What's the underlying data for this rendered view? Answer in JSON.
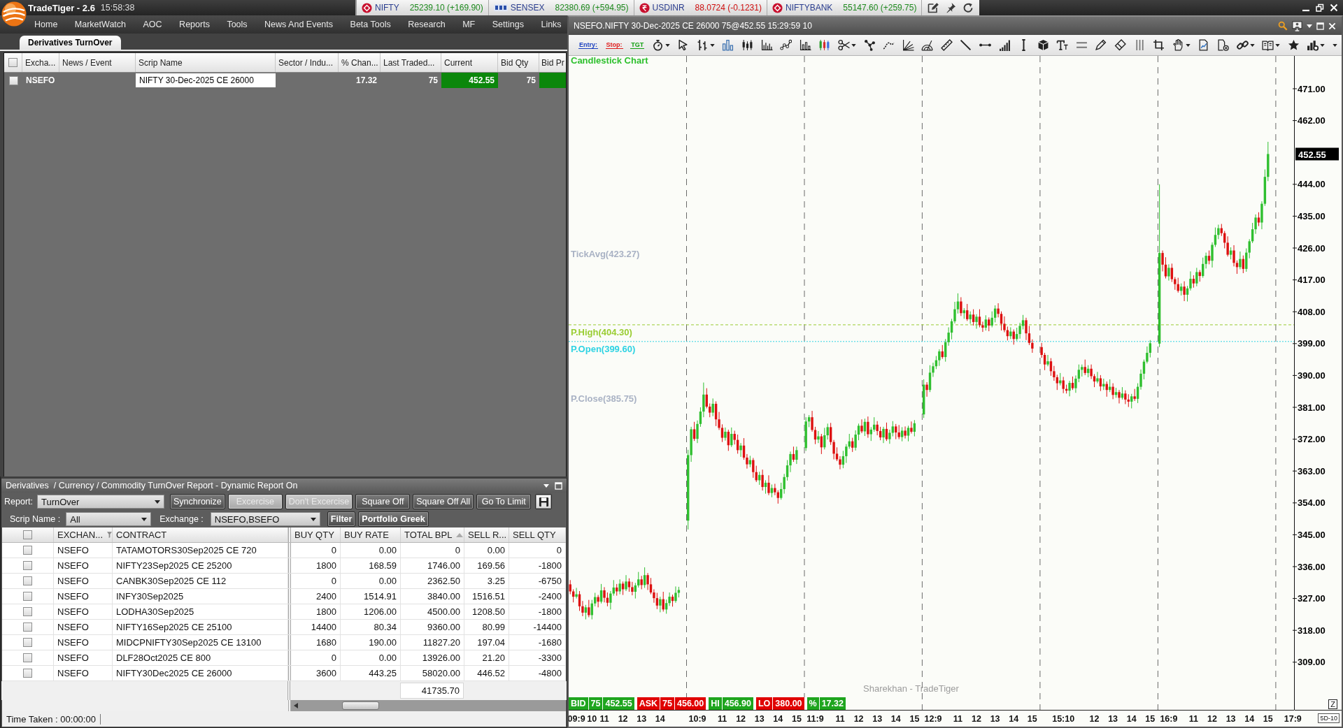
{
  "app": {
    "title": "TradeTiger - 2.6",
    "clock": "15:58:38"
  },
  "tickers": [
    {
      "name": "NIFTY",
      "value": "25239.10 (+169.90)",
      "rising": true,
      "kind": "nse"
    },
    {
      "name": "SENSEX",
      "value": "82380.69 (+594.95)",
      "rising": true,
      "kind": "bse"
    },
    {
      "name": "USDINR",
      "value": "88.0724 (-0.1231)",
      "rising": false,
      "kind": "rupee"
    },
    {
      "name": "NIFTYBANK",
      "value": "55147.60 (+259.75)",
      "rising": true,
      "kind": "nse"
    }
  ],
  "menu": [
    "Home",
    "MarketWatch",
    "AOC",
    "Reports",
    "Tools",
    "News And Events",
    "Beta Tools",
    "Research",
    "MF",
    "Settings",
    "Links"
  ],
  "watchlist": {
    "tabs": [
      {
        "label": "Derivatives TurnOver",
        "selected": true
      }
    ],
    "header_checked": false,
    "columns": [
      "Excha...",
      "News / Event",
      "Scrip Name",
      "Sector / Indu...",
      "% Chan...",
      "Last Traded...",
      "Current",
      "Bid Qty",
      "Bid Pr"
    ],
    "rows": [
      {
        "checked": false,
        "exchange": "NSEFO",
        "scrip_name": "NIFTY 30-Dec-2025 CE 26000",
        "change_pct": "17.32",
        "last_traded": "75",
        "current": "452.55",
        "bid_qty": "75",
        "rising": true
      }
    ]
  },
  "report": {
    "title": "Derivatives  / Currency / Commodity TurnOver Report - Dynamic Report On",
    "report_label": "Report:",
    "report_type": "TurnOver",
    "buttons": [
      {
        "label": "Synchronize",
        "disabled": false
      },
      {
        "label": "Excercise",
        "disabled": true
      },
      {
        "label": "Don't Excercise",
        "disabled": true
      },
      {
        "label": "Square Off",
        "disabled": false
      },
      {
        "label": "Square Off All",
        "disabled": false
      },
      {
        "label": "Go To Limit",
        "disabled": false
      }
    ],
    "scrip_label": "Scrip Name :",
    "scrip_name": "All",
    "exchange_label": "Exchange :",
    "exchange": "NSEFO,BSEFO",
    "filter_buttons": [
      "Filter",
      "Portfolio Greek"
    ],
    "header_checked": false,
    "columns": [
      {
        "label": "EXCHAN...",
        "filter": true,
        "sorted": false
      },
      {
        "label": "CONTRACT",
        "filter": false,
        "sorted": false
      },
      {
        "label": "BUY QTY",
        "filter": false,
        "sorted": false
      },
      {
        "label": "BUY RATE",
        "filter": false,
        "sorted": false
      },
      {
        "label": "TOTAL BPL",
        "filter": false,
        "sorted": true
      },
      {
        "label": "SELL R...",
        "filter": false,
        "sorted": false
      },
      {
        "label": "SELL QTY",
        "filter": false,
        "sorted": false
      }
    ],
    "rows": [
      {
        "checked": false,
        "exchange": "NSEFO",
        "contract": "TATAMOTORS30Sep2025 CE 720",
        "buy_qty": "0",
        "buy_rate": "0.00",
        "total_bpl": "0",
        "sell_rate": "0.00",
        "sell_qty": "0"
      },
      {
        "checked": false,
        "exchange": "NSEFO",
        "contract": "NIFTY23Sep2025 CE 25200",
        "buy_qty": "1800",
        "buy_rate": "168.59",
        "total_bpl": "1746.00",
        "sell_rate": "169.56",
        "sell_qty": "-1800"
      },
      {
        "checked": false,
        "exchange": "NSEFO",
        "contract": "CANBK30Sep2025 CE 112",
        "buy_qty": "0",
        "buy_rate": "0.00",
        "total_bpl": "2362.50",
        "sell_rate": "3.25",
        "sell_qty": "-6750"
      },
      {
        "checked": false,
        "exchange": "NSEFO",
        "contract": "INFY30Sep2025",
        "buy_qty": "2400",
        "buy_rate": "1514.91",
        "total_bpl": "3840.00",
        "sell_rate": "1516.51",
        "sell_qty": "-2400"
      },
      {
        "checked": false,
        "exchange": "NSEFO",
        "contract": "LODHA30Sep2025",
        "buy_qty": "1800",
        "buy_rate": "1206.00",
        "total_bpl": "4500.00",
        "sell_rate": "1208.50",
        "sell_qty": "-1800"
      },
      {
        "checked": false,
        "exchange": "NSEFO",
        "contract": "NIFTY16Sep2025 CE 25100",
        "buy_qty": "14400",
        "buy_rate": "80.34",
        "total_bpl": "9360.00",
        "sell_rate": "80.99",
        "sell_qty": "-14400"
      },
      {
        "checked": false,
        "exchange": "NSEFO",
        "contract": "MIDCPNIFTY30Sep2025 CE 13100",
        "buy_qty": "1680",
        "buy_rate": "190.00",
        "total_bpl": "11827.20",
        "sell_rate": "197.04",
        "sell_qty": "-1680"
      },
      {
        "checked": false,
        "exchange": "NSEFO",
        "contract": "DLF28Oct2025 CE 800",
        "buy_qty": "0",
        "buy_rate": "0.00",
        "total_bpl": "13926.00",
        "sell_rate": "21.20",
        "sell_qty": "-3300"
      },
      {
        "checked": false,
        "exchange": "NSEFO",
        "contract": "NIFTY30Dec2025 CE 26000",
        "buy_qty": "3600",
        "buy_rate": "443.25",
        "total_bpl": "58020.00",
        "sell_rate": "446.52",
        "sell_qty": "-4800"
      }
    ],
    "total_bpl": "41735.70",
    "status": "Time Taken : 00:00:00"
  },
  "chart": {
    "title": "NSEFO.NIFTY 30-Dec-2025 CE 26000 75@452.55 15:29:59 10",
    "order_tags": [
      {
        "label": "Entry:",
        "color": "#1a3fc0"
      },
      {
        "label": "Stop:",
        "color": "#e01b1b"
      },
      {
        "label": "TGT",
        "color": "#12a012"
      }
    ],
    "chart_data": {
      "type": "candlestick",
      "title": "Candlestick Chart",
      "categories": [
        null,
        null,
        "09:9",
        null,
        null,
        null,
        null,
        "10",
        null,
        null,
        null,
        "11",
        null,
        null,
        null,
        null,
        null,
        "12",
        null,
        null,
        null,
        null,
        null,
        "13",
        null,
        null,
        null,
        null,
        null,
        "14",
        null,
        null,
        null,
        null,
        null,
        null,
        null,
        null,
        null,
        null,
        null,
        "10:9",
        null,
        null,
        null,
        null,
        null,
        null,
        null,
        "11",
        null,
        null,
        null,
        null,
        null,
        "12",
        null,
        null,
        null,
        null,
        null,
        "13",
        null,
        null,
        null,
        null,
        null,
        "14",
        null,
        null,
        null,
        null,
        null,
        "15",
        null,
        null,
        null,
        null,
        null,
        "11:9",
        null,
        null,
        null,
        null,
        null,
        null,
        null,
        "11",
        null,
        null,
        null,
        null,
        null,
        "12",
        null,
        null,
        null,
        null,
        null,
        "13",
        null,
        null,
        null,
        null,
        null,
        "14",
        null,
        null,
        null,
        null,
        null,
        "15",
        null,
        null,
        null,
        null,
        null,
        "12:9",
        null,
        null,
        null,
        null,
        null,
        null,
        null,
        "11",
        null,
        null,
        null,
        null,
        null,
        "12",
        null,
        null,
        null,
        null,
        null,
        "13",
        null,
        null,
        null,
        null,
        null,
        "14",
        null,
        null,
        null,
        null,
        null,
        "15",
        null,
        null,
        null,
        null,
        null,
        null,
        null,
        null,
        null,
        "15:10",
        null,
        null,
        null,
        null,
        null,
        null,
        null,
        null,
        null,
        "12",
        null,
        null,
        null,
        null,
        null,
        "13",
        null,
        null,
        null,
        null,
        null,
        "14",
        null,
        null,
        null,
        null,
        null,
        "15",
        null,
        null,
        null,
        null,
        null,
        "16:9",
        null,
        null,
        null,
        null,
        null,
        null,
        null,
        "11",
        null,
        null,
        null,
        null,
        null,
        "12",
        null,
        null,
        null,
        null,
        null,
        "13",
        null,
        null,
        null,
        null,
        null,
        "14",
        null,
        null,
        null,
        null,
        null,
        "15",
        null,
        null,
        null,
        null,
        null,
        null,
        null,
        "17:9"
      ],
      "ohlc": [
        [
          331.0,
          332.2,
          328.2,
          329.0
        ],
        [
          329.0,
          329.6,
          325.9,
          327.5
        ],
        [
          327.5,
          330.0,
          327.0,
          328.2
        ],
        [
          328.2,
          329.1,
          323.5,
          324.8
        ],
        [
          324.8,
          326.3,
          322.0,
          323.0
        ],
        [
          323.0,
          325.2,
          321.1,
          324.5
        ],
        [
          324.5,
          326.6,
          321.7,
          322.3
        ],
        [
          322.3,
          326.6,
          321.1,
          325.6
        ],
        [
          325.6,
          328.6,
          324.8,
          327.4
        ],
        [
          327.4,
          328.0,
          324.5,
          326.1
        ],
        [
          326.1,
          331.1,
          325.6,
          329.3
        ],
        [
          329.3,
          330.2,
          325.9,
          327.2
        ],
        [
          327.2,
          328.7,
          324.8,
          325.8
        ],
        [
          325.8,
          329.1,
          323.9,
          328.4
        ],
        [
          328.4,
          332.2,
          327.8,
          330.1
        ],
        [
          330.1,
          331.1,
          327.8,
          329.0
        ],
        [
          329.0,
          332.4,
          328.2,
          331.2
        ],
        [
          331.2,
          331.8,
          328.0,
          329.6
        ],
        [
          329.6,
          333.6,
          329.1,
          331.8
        ],
        [
          331.8,
          332.7,
          328.9,
          330.2
        ],
        [
          330.2,
          331.7,
          327.9,
          328.9
        ],
        [
          328.9,
          331.4,
          327.0,
          330.7
        ],
        [
          330.7,
          334.5,
          330.1,
          332.4
        ],
        [
          332.4,
          333.4,
          329.6,
          330.8
        ],
        [
          330.8,
          335.8,
          330.0,
          333.6
        ],
        [
          333.6,
          334.2,
          329.4,
          331.0
        ],
        [
          331.0,
          332.8,
          328.2,
          328.7
        ],
        [
          328.7,
          329.6,
          325.8,
          327.1
        ],
        [
          327.1,
          328.6,
          324.0,
          325.0
        ],
        [
          325.0,
          327.5,
          323.1,
          326.8
        ],
        [
          326.8,
          328.9,
          323.3,
          323.9
        ],
        [
          323.9,
          326.7,
          322.7,
          325.7
        ],
        [
          325.7,
          328.7,
          324.9,
          327.5
        ],
        [
          327.5,
          328.1,
          324.7,
          326.3
        ],
        [
          326.3,
          330.4,
          325.8,
          328.6
        ],
        [
          328.6,
          330.3,
          327.3,
          329.4
        ],
        null,
        null,
        [
          349.0,
          369.0,
          346.5,
          367.5
        ],
        [
          367.5,
          375.5,
          365.6,
          374.8
        ],
        [
          374.8,
          376.9,
          371.5,
          372.1
        ],
        [
          372.1,
          377.3,
          370.9,
          376.3
        ],
        [
          376.3,
          381.0,
          375.5,
          379.8
        ],
        [
          379.8,
          388.0,
          378.2,
          384.6
        ],
        [
          384.6,
          386.4,
          380.7,
          381.2
        ],
        [
          381.2,
          382.1,
          378.2,
          379.5
        ],
        [
          379.5,
          383.5,
          378.5,
          382.0
        ],
        [
          382.0,
          382.7,
          375.7,
          377.6
        ],
        [
          377.6,
          379.7,
          374.6,
          375.2
        ],
        [
          375.2,
          376.2,
          371.2,
          372.4
        ],
        [
          372.4,
          375.3,
          371.6,
          374.1
        ],
        [
          374.1,
          374.7,
          368.7,
          370.3
        ],
        [
          370.3,
          375.3,
          369.8,
          373.5
        ],
        [
          373.5,
          374.4,
          370.5,
          371.8
        ],
        [
          371.8,
          373.3,
          367.9,
          368.9
        ],
        [
          368.9,
          370.9,
          367.0,
          370.2
        ],
        [
          370.2,
          372.3,
          366.2,
          366.8
        ],
        [
          366.8,
          367.8,
          363.7,
          364.9
        ],
        [
          364.9,
          367.3,
          364.1,
          366.1
        ],
        [
          366.1,
          366.7,
          361.1,
          362.7
        ],
        [
          362.7,
          364.5,
          359.9,
          360.4
        ],
        [
          360.4,
          362.8,
          359.1,
          361.9
        ],
        [
          361.9,
          363.4,
          357.5,
          358.5
        ],
        [
          358.5,
          360.4,
          356.6,
          359.7
        ],
        [
          359.7,
          361.8,
          356.2,
          356.8
        ],
        [
          356.8,
          359.2,
          355.6,
          358.2
        ],
        [
          358.2,
          359.4,
          356.2,
          357.0
        ],
        [
          357.0,
          357.6,
          353.8,
          355.4
        ],
        [
          355.4,
          359.7,
          354.9,
          357.9
        ],
        [
          357.9,
          362.2,
          356.6,
          361.3
        ],
        [
          361.3,
          366.1,
          360.3,
          364.6
        ],
        [
          364.6,
          368.5,
          362.7,
          367.8
        ],
        [
          367.8,
          369.9,
          365.6,
          366.2
        ],
        [
          366.2,
          369.9,
          365.0,
          368.9
        ],
        null,
        null,
        [
          369.5,
          378.2,
          368.7,
          377.0
        ],
        [
          377.0,
          378.8,
          375.4,
          378.2
        ],
        [
          378.2,
          380.0,
          374.1,
          374.6
        ],
        [
          374.6,
          375.5,
          370.6,
          371.9
        ],
        [
          371.9,
          374.3,
          370.9,
          372.8
        ],
        [
          372.8,
          373.5,
          367.8,
          369.7
        ],
        [
          369.7,
          375.2,
          369.1,
          373.1
        ],
        [
          373.1,
          376.4,
          371.9,
          375.4
        ],
        [
          375.4,
          376.6,
          370.4,
          371.2
        ],
        [
          371.2,
          371.8,
          366.3,
          367.9
        ],
        [
          367.9,
          369.7,
          365.8,
          366.3
        ],
        [
          366.3,
          367.2,
          363.5,
          364.8
        ],
        [
          364.8,
          368.7,
          363.8,
          367.2
        ],
        [
          367.2,
          370.6,
          365.3,
          369.9
        ],
        [
          369.9,
          373.5,
          369.3,
          371.4
        ],
        [
          371.4,
          372.4,
          368.4,
          369.6
        ],
        [
          369.6,
          374.5,
          368.8,
          373.3
        ],
        [
          373.3,
          376.4,
          371.7,
          375.8
        ],
        [
          375.8,
          377.6,
          373.7,
          374.2
        ],
        [
          374.2,
          377.8,
          372.9,
          376.9
        ],
        [
          376.9,
          378.4,
          372.4,
          373.4
        ],
        [
          373.4,
          375.4,
          371.5,
          374.7
        ],
        [
          374.7,
          378.2,
          374.1,
          376.1
        ],
        [
          376.1,
          377.1,
          373.1,
          374.3
        ],
        [
          374.3,
          375.5,
          371.7,
          372.5
        ],
        [
          372.5,
          375.5,
          370.9,
          374.9
        ],
        [
          374.9,
          376.7,
          371.5,
          372.0
        ],
        [
          372.0,
          374.7,
          370.7,
          373.8
        ],
        [
          373.8,
          377.1,
          372.8,
          375.6
        ],
        [
          375.6,
          376.3,
          372.0,
          373.9
        ],
        [
          373.9,
          376.0,
          372.0,
          372.6
        ],
        [
          372.6,
          375.4,
          371.4,
          374.4
        ],
        [
          374.4,
          375.6,
          372.2,
          373.0
        ],
        [
          373.0,
          375.8,
          371.4,
          375.2
        ],
        [
          375.2,
          377.0,
          373.6,
          374.1
        ],
        [
          374.1,
          377.4,
          372.8,
          376.5
        ],
        null,
        null,
        [
          379.0,
          388.9,
          378.0,
          387.4
        ],
        [
          387.4,
          388.1,
          384.0,
          385.9
        ],
        [
          385.9,
          392.9,
          385.3,
          390.8
        ],
        [
          390.8,
          393.6,
          389.6,
          392.6
        ],
        [
          392.6,
          395.5,
          391.8,
          394.3
        ],
        [
          394.3,
          397.4,
          392.7,
          396.8
        ],
        [
          396.8,
          398.6,
          394.7,
          395.2
        ],
        [
          395.2,
          400.3,
          393.9,
          399.4
        ],
        [
          399.4,
          403.6,
          398.4,
          402.1
        ],
        [
          402.1,
          406.0,
          400.2,
          405.3
        ],
        [
          405.3,
          410.8,
          404.7,
          408.7
        ],
        [
          408.7,
          413.2,
          407.5,
          410.9
        ],
        [
          410.9,
          412.1,
          406.8,
          407.6
        ],
        [
          407.6,
          409.0,
          406.0,
          408.4
        ],
        [
          408.4,
          410.2,
          405.4,
          405.9
        ],
        [
          405.9,
          408.1,
          404.6,
          407.2
        ],
        [
          407.2,
          408.7,
          404.1,
          405.1
        ],
        [
          405.1,
          407.3,
          403.2,
          406.6
        ],
        [
          406.6,
          408.7,
          403.6,
          404.2
        ],
        [
          404.2,
          405.2,
          402.3,
          403.5
        ],
        [
          403.5,
          407.0,
          402.7,
          405.8
        ],
        [
          405.8,
          406.4,
          402.5,
          404.1
        ],
        [
          404.1,
          408.1,
          403.6,
          406.3
        ],
        [
          406.3,
          409.8,
          405.0,
          408.9
        ],
        [
          408.9,
          410.4,
          406.4,
          407.4
        ],
        [
          407.4,
          408.1,
          402.7,
          404.6
        ],
        [
          404.6,
          406.7,
          402.2,
          402.8
        ],
        [
          402.8,
          403.8,
          399.9,
          401.1
        ],
        [
          401.1,
          403.6,
          400.3,
          402.4
        ],
        [
          402.4,
          403.0,
          398.7,
          400.3
        ],
        [
          400.3,
          403.5,
          399.8,
          401.7
        ],
        [
          401.7,
          404.9,
          400.4,
          404.0
        ],
        [
          404.0,
          407.1,
          403.0,
          405.6
        ],
        [
          405.6,
          406.3,
          400.0,
          401.9
        ],
        [
          401.9,
          404.0,
          398.6,
          399.2
        ],
        [
          399.2,
          400.2,
          396.4,
          397.6
        ],
        null,
        null,
        [
          398.0,
          399.2,
          395.0,
          395.8
        ],
        [
          395.8,
          396.4,
          391.5,
          393.1
        ],
        [
          393.1,
          395.8,
          392.6,
          394.0
        ],
        [
          394.0,
          394.9,
          389.9,
          391.2
        ],
        [
          391.2,
          392.7,
          388.5,
          389.5
        ],
        [
          389.5,
          390.2,
          385.9,
          387.8
        ],
        [
          387.8,
          390.7,
          387.2,
          388.6
        ],
        [
          388.6,
          389.6,
          385.0,
          386.2
        ],
        [
          386.2,
          387.4,
          384.9,
          385.7
        ],
        [
          385.7,
          388.5,
          384.1,
          387.9
        ],
        [
          387.9,
          389.7,
          385.9,
          386.4
        ],
        [
          386.4,
          390.0,
          385.1,
          389.1
        ],
        [
          389.1,
          393.1,
          388.1,
          391.6
        ],
        [
          391.6,
          393.1,
          389.7,
          392.4
        ],
        [
          392.4,
          394.5,
          390.1,
          390.7
        ],
        [
          390.7,
          392.9,
          389.5,
          391.9
        ],
        [
          391.9,
          393.1,
          389.0,
          389.8
        ],
        [
          389.8,
          390.4,
          386.7,
          388.3
        ],
        [
          388.3,
          391.0,
          387.8,
          389.2
        ],
        [
          389.2,
          390.1,
          385.6,
          386.9
        ],
        [
          386.9,
          389.1,
          385.9,
          387.6
        ],
        [
          387.6,
          388.3,
          384.0,
          385.9
        ],
        [
          385.9,
          388.9,
          385.3,
          386.8
        ],
        [
          386.8,
          387.8,
          383.3,
          384.5
        ],
        [
          384.5,
          386.5,
          383.7,
          385.3
        ],
        [
          385.3,
          385.9,
          382.1,
          383.7
        ],
        [
          383.7,
          386.7,
          383.2,
          384.9
        ],
        [
          384.9,
          385.8,
          381.9,
          383.2
        ],
        [
          383.2,
          384.7,
          381.1,
          382.6
        ],
        [
          382.6,
          384.8,
          380.7,
          384.1
        ],
        [
          384.1,
          386.2,
          382.8,
          383.4
        ],
        [
          383.4,
          387.8,
          382.2,
          386.8
        ],
        [
          386.8,
          391.7,
          386.0,
          390.5
        ],
        [
          390.5,
          394.5,
          388.9,
          393.9
        ],
        [
          393.9,
          398.2,
          393.4,
          396.4
        ],
        [
          396.4,
          400.0,
          395.1,
          399.1
        ],
        null,
        null,
        [
          399.0,
          444.0,
          398.0,
          424.6
        ],
        [
          424.6,
          425.3,
          419.4,
          421.3
        ],
        [
          421.3,
          423.4,
          417.4,
          418.0
        ],
        [
          418.0,
          421.4,
          416.8,
          420.4
        ],
        [
          420.4,
          421.6,
          416.4,
          417.2
        ],
        [
          417.2,
          417.8,
          414.2,
          415.8
        ],
        [
          415.8,
          417.6,
          413.4,
          413.9
        ],
        [
          413.9,
          416.0,
          412.6,
          415.1
        ],
        [
          415.1,
          416.6,
          411.0,
          412.8
        ],
        [
          412.8,
          415.3,
          410.9,
          414.6
        ],
        [
          414.6,
          419.4,
          414.0,
          417.3
        ],
        [
          417.3,
          418.3,
          414.8,
          416.0
        ],
        [
          416.0,
          420.4,
          415.2,
          419.2
        ],
        [
          419.2,
          419.8,
          416.5,
          418.1
        ],
        [
          418.1,
          423.3,
          417.6,
          421.5
        ],
        [
          421.5,
          424.7,
          420.2,
          423.8
        ],
        [
          423.8,
          425.3,
          421.4,
          422.4
        ],
        [
          422.4,
          427.6,
          420.5,
          426.9
        ],
        [
          426.9,
          431.8,
          426.3,
          429.7
        ],
        [
          429.7,
          432.6,
          428.5,
          431.6
        ],
        [
          431.6,
          432.8,
          429.4,
          430.2
        ],
        [
          430.2,
          430.8,
          425.9,
          427.5
        ],
        [
          427.5,
          429.3,
          423.6,
          424.1
        ],
        [
          424.1,
          426.2,
          422.8,
          425.3
        ],
        [
          425.3,
          426.8,
          420.8,
          421.8
        ],
        [
          421.8,
          422.5,
          418.7,
          420.6
        ],
        [
          420.6,
          425.0,
          420.0,
          422.9
        ],
        [
          422.9,
          423.9,
          418.9,
          420.1
        ],
        [
          420.1,
          425.9,
          419.3,
          424.7
        ],
        [
          424.7,
          428.5,
          423.1,
          427.9
        ],
        [
          427.9,
          433.1,
          427.4,
          431.3
        ],
        [
          431.3,
          435.5,
          430.0,
          434.6
        ],
        [
          434.6,
          436.1,
          432.2,
          433.2
        ],
        [
          433.2,
          439.2,
          431.3,
          438.5
        ],
        [
          438.5,
          448.2,
          437.9,
          446.1
        ],
        [
          446.1,
          456.0,
          444.9,
          452.55
        ],
        null,
        null,
        null,
        null,
        null,
        null,
        null,
        null
      ],
      "ylim": [
        295.55,
        480.27
      ],
      "yticks": [
        {
          "value": 471,
          "label": "471.00"
        },
        {
          "value": 462,
          "label": "462.00"
        },
        {
          "value": 444,
          "label": "444.00"
        },
        {
          "value": 435,
          "label": "435.00"
        },
        {
          "value": 426,
          "label": "426.00"
        },
        {
          "value": 417,
          "label": "417.00"
        },
        {
          "value": 408,
          "label": "408.00"
        },
        {
          "value": 399,
          "label": "399.00"
        },
        {
          "value": 390,
          "label": "390.00"
        },
        {
          "value": 381,
          "label": "381.00"
        },
        {
          "value": 372,
          "label": "372.00"
        },
        {
          "value": 363,
          "label": "363.00"
        },
        {
          "value": 354,
          "label": "354.00"
        },
        {
          "value": 345,
          "label": "345.00"
        },
        {
          "value": 336,
          "label": "336.00"
        },
        {
          "value": 327,
          "label": "327.00"
        },
        {
          "value": 318,
          "label": "318.00"
        },
        {
          "value": 309,
          "label": "309.00"
        }
      ],
      "ref_lines": [
        {
          "axis": "y",
          "value": 404.3,
          "label": "P.High(404.30)",
          "color": "#9acd32"
        },
        {
          "axis": "y",
          "value": 399.6,
          "label": "P.Open(399.60)",
          "color": "#2fd3e3"
        }
      ],
      "annotations": [
        "TickAvg(423.27)",
        "P.Close(385.75)"
      ]
    },
    "last_price": "452.55",
    "watermark": "Sharekhan - TradeTiger",
    "quote_bar": [
      {
        "label": "BID",
        "values": [
          "75",
          "452.55"
        ],
        "color": "#1ea51e"
      },
      {
        "label": "ASK",
        "values": [
          "75",
          "456.00"
        ],
        "color": "#e00000"
      },
      {
        "label": "HI",
        "values": [
          "456.90"
        ],
        "color": "#1ea51e"
      },
      {
        "label": "LO",
        "values": [
          "380.00"
        ],
        "color": "#e00000"
      },
      {
        "label": "%",
        "values": [
          "17.32"
        ],
        "color": "#1ea51e"
      }
    ],
    "zoom_button": "Z",
    "period": "5D-10"
  }
}
